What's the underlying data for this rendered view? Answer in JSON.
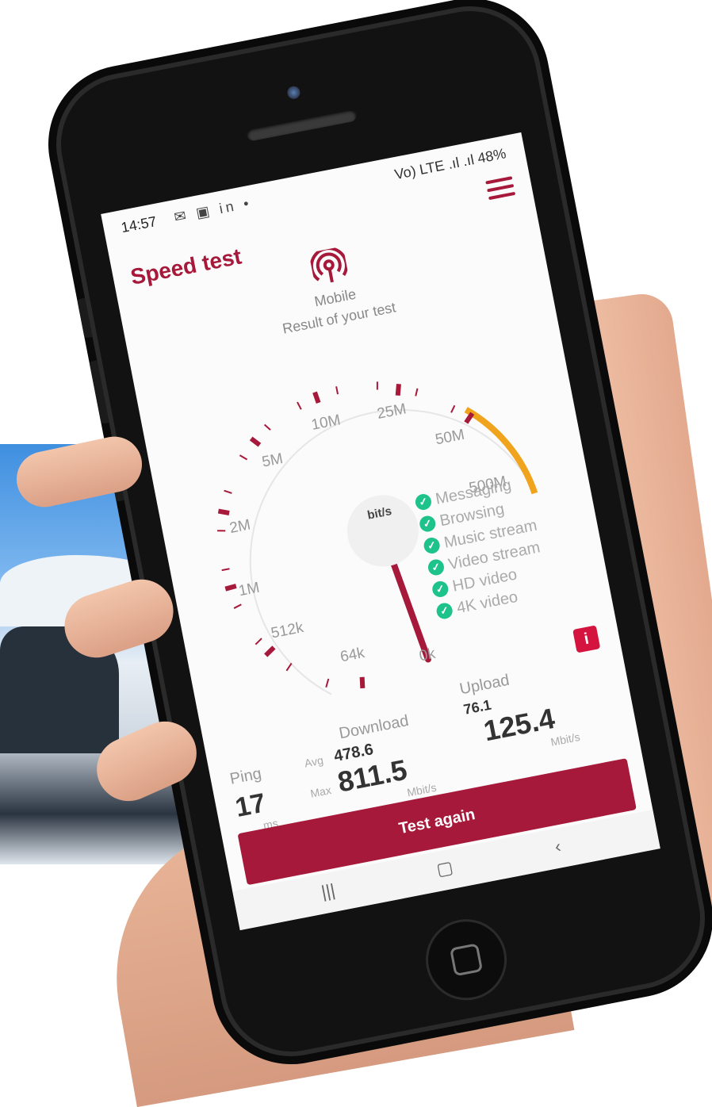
{
  "status_bar": {
    "time": "14:57",
    "left_icons": "✉ ▣ in •",
    "right_text": "Vo) LTE .ıl .ıl 48%"
  },
  "header": {
    "title": "Speed test"
  },
  "connection": {
    "type_label": "Mobile",
    "subtitle": "Result of your test"
  },
  "gauge": {
    "unit": "bit/s",
    "ticks": [
      "0k",
      "64k",
      "512k",
      "1M",
      "2M",
      "5M",
      "10M",
      "25M",
      "50M",
      "500M"
    ],
    "accent_color": "#a6193a",
    "top_band_color": "#f0a41e"
  },
  "capabilities": [
    {
      "label": "Messaging"
    },
    {
      "label": "Browsing"
    },
    {
      "label": "Music stream"
    },
    {
      "label": "Video stream"
    },
    {
      "label": "HD video"
    },
    {
      "label": "4K video"
    }
  ],
  "results": {
    "ping": {
      "label": "Ping",
      "value": "17",
      "unit": "ms"
    },
    "download": {
      "label": "Download",
      "avg_label": "Avg",
      "avg_value": "478.6",
      "max_label": "Max",
      "max_value": "811.5",
      "unit": "Mbit/s"
    },
    "upload": {
      "label": "Upload",
      "avg_value": "76.1",
      "max_value": "125.4",
      "unit": "Mbit/s"
    }
  },
  "actions": {
    "test_again": "Test again"
  },
  "colors": {
    "brand": "#a6193a",
    "check": "#1ec28b"
  }
}
